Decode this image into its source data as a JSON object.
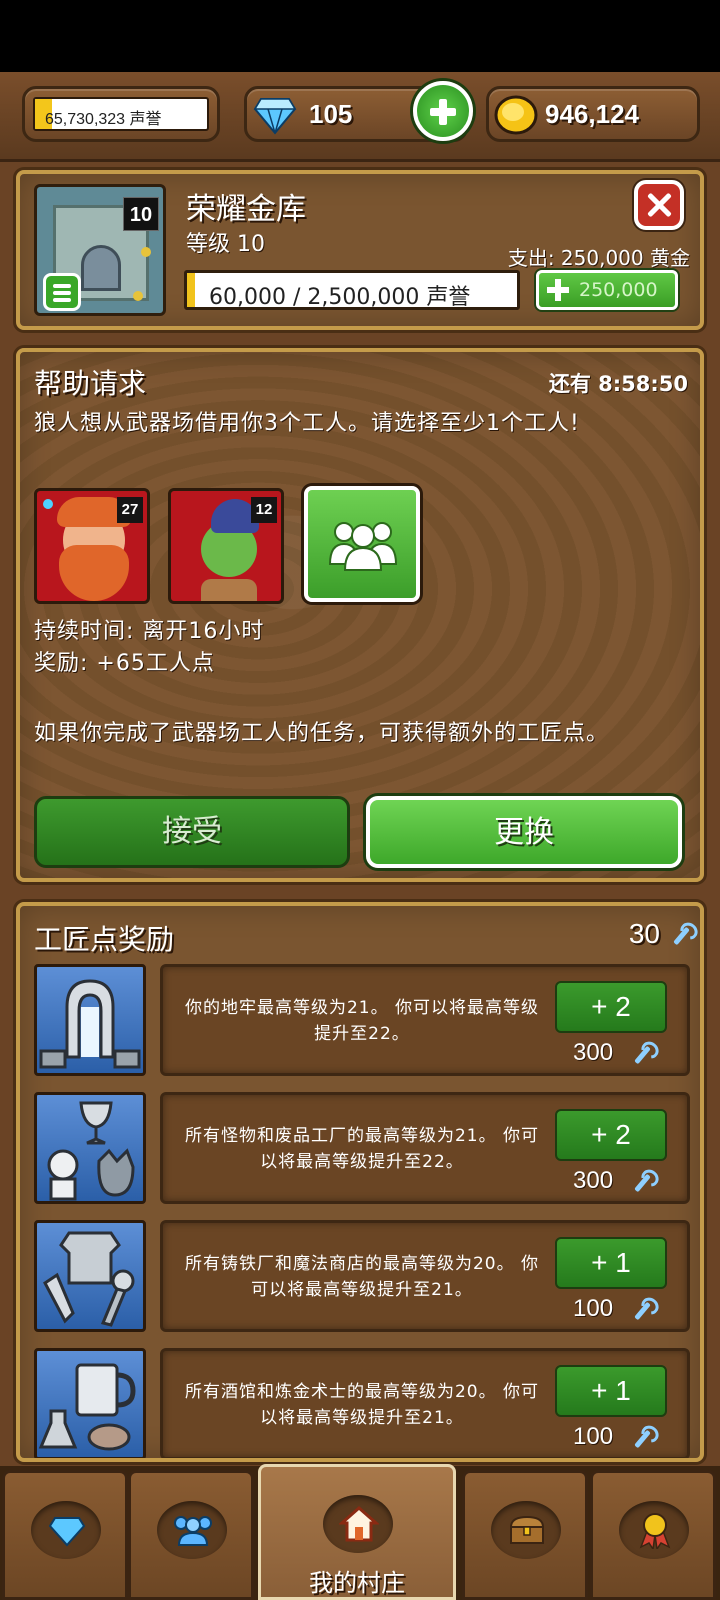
{
  "hud": {
    "reputation": "65,730,323 声誉",
    "reputation_progress": 0.1,
    "gems": "105",
    "gold": "946,124"
  },
  "building": {
    "title": "荣耀金库",
    "level_badge": "10",
    "level_text": "等级 10",
    "expense": "支出: 250,000 黄金",
    "reputation_bar": "60,000 / 2,500,000 声誉",
    "reputation_progress": 0.024,
    "buy_label": "250,000"
  },
  "help_request": {
    "title": "帮助请求",
    "timer": "还有 8:58:50",
    "description": "狼人想从武器场借用你3个工人。请选择至少1个工人!",
    "workers": [
      {
        "level": "27"
      },
      {
        "level": "12"
      }
    ],
    "duration": "持续时间: 离开16小时",
    "reward": "奖励: +65工人点",
    "note": "如果你完成了武器场工人的任务，可获得额外的工匠点。",
    "accept_label": "接受",
    "swap_label": "更换"
  },
  "craft_rewards": {
    "title": "工匠点奖励",
    "points": "30",
    "items": [
      {
        "text": "你的地牢最高等级为21。 你可以将最高等级提升至22。",
        "button": "+ 2",
        "cost": "300"
      },
      {
        "text": "所有怪物和废品工厂的最高等级为21。 你可以将最高等级提升至22。",
        "button": "+ 2",
        "cost": "300"
      },
      {
        "text": "所有铸铁厂和魔法商店的最高等级为20。 你可以将最高等级提升至21。",
        "button": "+ 1",
        "cost": "100"
      },
      {
        "text": "所有酒馆和炼金术士的最高等级为20。 你可以将最高等级提升至21。",
        "button": "+ 1",
        "cost": "100"
      }
    ]
  },
  "nav": {
    "tabs": [
      {
        "icon": "gem-icon"
      },
      {
        "icon": "people-icon"
      },
      {
        "icon": "house-icon",
        "label": "我的村庄"
      },
      {
        "icon": "chest-icon"
      },
      {
        "icon": "medal-icon"
      }
    ]
  }
}
